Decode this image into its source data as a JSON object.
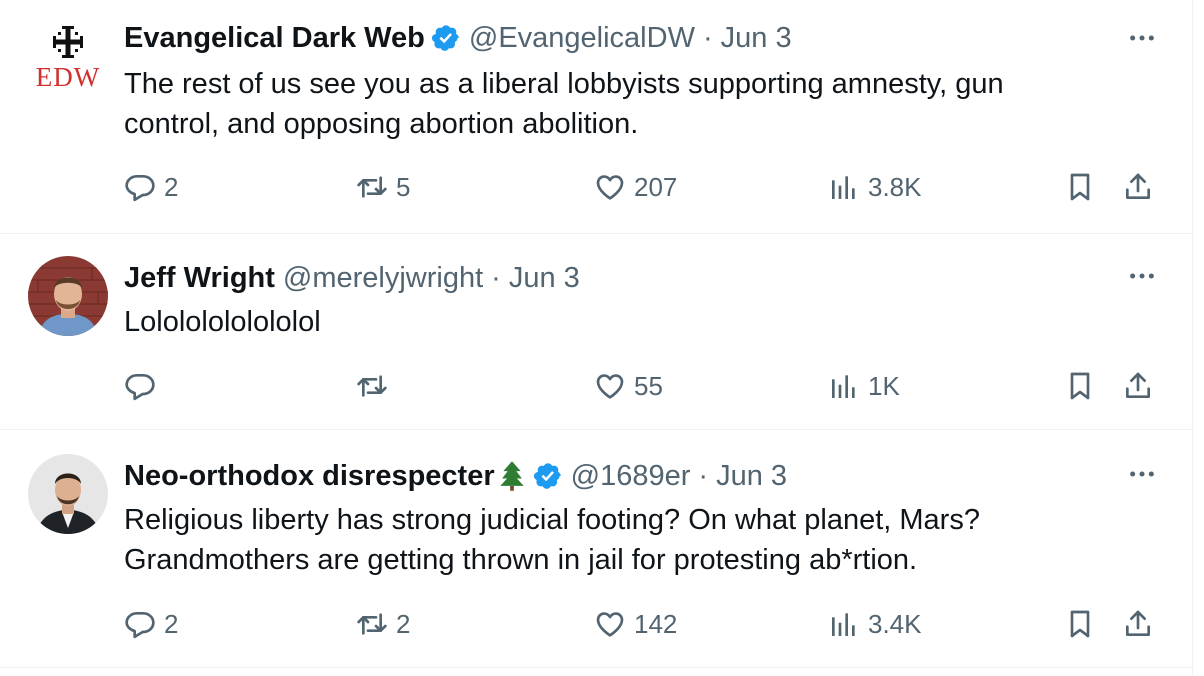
{
  "tweets": [
    {
      "avatar_icon": "edw-cross-logo",
      "avatar_logo_text": "EDW",
      "author_name": "Evangelical Dark Web",
      "verified": true,
      "handle": "@EvangelicalDW",
      "separator": "·",
      "date": "Jun 3",
      "text_lines": [
        "The rest of us see you as a liberal lobbyists supporting amnesty, gun",
        "control, and opposing abortion abolition."
      ],
      "replies": "2",
      "reposts": "5",
      "likes": "207",
      "views": "3.8K"
    },
    {
      "avatar_icon": "profile-photo",
      "author_name": "Jeff Wright",
      "verified": false,
      "handle": "@merelyjwright",
      "separator": "·",
      "date": "Jun 3",
      "text_lines": [
        "Lolololololololol"
      ],
      "replies": "",
      "reposts": "",
      "likes": "55",
      "views": "1K"
    },
    {
      "avatar_icon": "profile-photo",
      "author_name": "Neo-orthodox disrespecter",
      "name_emoji": "evergreen-tree-icon",
      "verified": true,
      "handle": "@1689er",
      "separator": "·",
      "date": "Jun 3",
      "text_lines": [
        "Religious liberty has strong judicial footing? On what planet, Mars?",
        "Grandmothers are getting thrown in jail for protesting ab*rtion."
      ],
      "replies": "2",
      "reposts": "2",
      "likes": "142",
      "views": "3.4K"
    }
  ],
  "colors": {
    "text_primary": "#0f1419",
    "text_secondary": "#536471",
    "verified_blue": "#1d9bf0",
    "divider": "#eff3f4",
    "logo_red": "#d0312d"
  }
}
